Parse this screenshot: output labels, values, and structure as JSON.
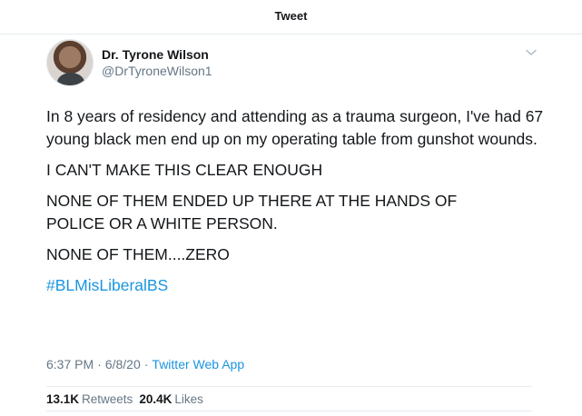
{
  "header": {
    "title": "Tweet"
  },
  "author": {
    "display_name": "Dr. Tyrone Wilson",
    "handle": "@DrTyroneWilson1",
    "avatar_icon": "profile-photo"
  },
  "menu": {
    "icon": "chevron-down-icon"
  },
  "tweet": {
    "paragraphs": [
      "In 8 years of residency and attending as a trauma surgeon, I've had 67 young black men end up on my operating table from gunshot wounds.",
      "I CAN'T MAKE THIS CLEAR ENOUGH",
      "NONE OF THEM ENDED UP THERE AT THE HANDS OF\nPOLICE OR A WHITE PERSON.",
      "NONE OF THEM....ZERO"
    ],
    "hashtag": "#BLMisLiberalBS"
  },
  "meta": {
    "time": "6:37 PM",
    "date": "6/8/20",
    "source": "Twitter Web App",
    "separator": "·"
  },
  "stats": {
    "retweets_count": "13.1K",
    "retweets_label": "Retweets",
    "likes_count": "20.4K",
    "likes_label": "Likes"
  },
  "colors": {
    "link": "#1b95e0",
    "secondary_text": "#657786",
    "divider": "#e6ecf0"
  }
}
